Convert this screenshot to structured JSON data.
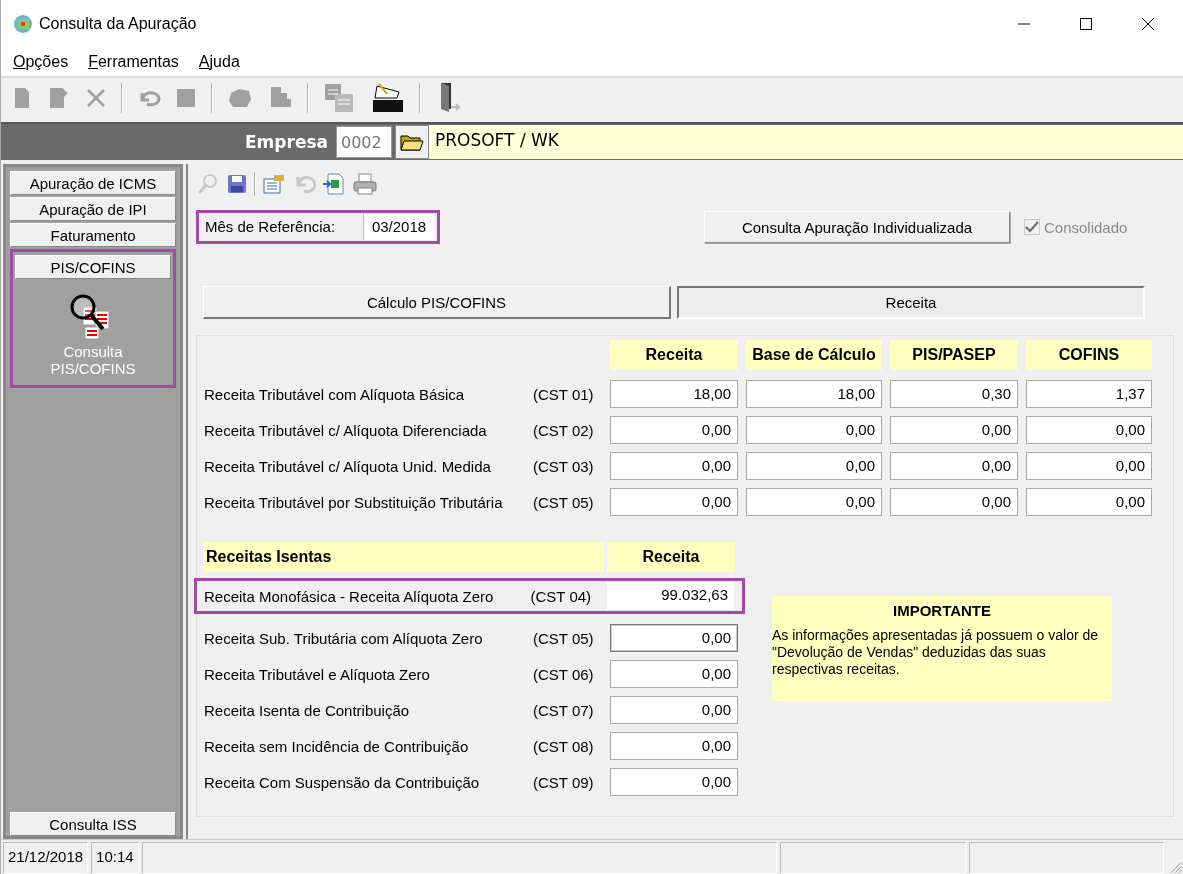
{
  "window": {
    "title": "Consulta da Apuração"
  },
  "menu": [
    {
      "label": "Opções"
    },
    {
      "label": "Ferramentas"
    },
    {
      "label": "Ajuda"
    }
  ],
  "empresa": {
    "label": "Empresa",
    "code": "0002",
    "name": "PROSOFT / WK"
  },
  "sidebar": {
    "items": [
      {
        "label": "Apuração de ICMS",
        "selected": false,
        "highlighted": false
      },
      {
        "label": "Apuração de IPI",
        "selected": false,
        "highlighted": false
      },
      {
        "label": "Faturamento",
        "selected": false,
        "highlighted": false
      },
      {
        "label": "PIS/COFINS",
        "selected": true,
        "highlighted": true
      }
    ],
    "launcher": {
      "label": "Consulta PIS/COFINS"
    },
    "bottom_item": {
      "label": "Consulta ISS"
    }
  },
  "reference": {
    "label": "Mês de Referência:",
    "value": "03/2018",
    "highlighted": true
  },
  "individual_button": {
    "label": "Consulta Apuração Individualizada"
  },
  "consolidated": {
    "label": "Consolidado",
    "checked": true,
    "disabled": true
  },
  "tabs": [
    {
      "label": "Cálculo PIS/COFINS",
      "selected": false
    },
    {
      "label": "Receita",
      "selected": true
    }
  ],
  "taxed": {
    "columns": [
      "Receita",
      "Base de Cálculo",
      "PIS/PASEP",
      "COFINS"
    ],
    "rows": [
      {
        "label": "Receita Tributável com Alíquota Básica",
        "cst": "(CST 01)",
        "values": [
          "18,00",
          "18,00",
          "0,30",
          "1,37"
        ]
      },
      {
        "label": "Receita Tributável c/ Alíquota Diferenciada",
        "cst": "(CST 02)",
        "values": [
          "0,00",
          "0,00",
          "0,00",
          "0,00"
        ]
      },
      {
        "label": "Receita Tributável c/ Alíquota Unid. Medida",
        "cst": "(CST 03)",
        "values": [
          "0,00",
          "0,00",
          "0,00",
          "0,00"
        ]
      },
      {
        "label": "Receita Tributável por Substituição Tributária",
        "cst": "(CST 05)",
        "values": [
          "0,00",
          "0,00",
          "0,00",
          "0,00"
        ]
      }
    ]
  },
  "exempt": {
    "title": "Receitas Isentas",
    "column": "Receita",
    "rows": [
      {
        "label": "Receita Monofásica - Receita Alíquota Zero",
        "cst": "(CST 04)",
        "value": "99.032,63",
        "highlighted": true,
        "focused": false
      },
      {
        "label": "Receita Sub. Tributária com Alíquota Zero",
        "cst": "(CST 05)",
        "value": "0,00",
        "highlighted": false,
        "focused": true
      },
      {
        "label": "Receita Tributável e Alíquota Zero",
        "cst": "(CST 06)",
        "value": "0,00",
        "highlighted": false,
        "focused": false
      },
      {
        "label": "Receita Isenta de Contribuição",
        "cst": "(CST 07)",
        "value": "0,00",
        "highlighted": false,
        "focused": false
      },
      {
        "label": "Receita sem Incidência de Contribuição",
        "cst": "(CST 08)",
        "value": "0,00",
        "highlighted": false,
        "focused": false
      },
      {
        "label": "Receita Com Suspensão da Contribuição",
        "cst": "(CST 09)",
        "value": "0,00",
        "highlighted": false,
        "focused": false
      }
    ]
  },
  "notice": {
    "title": "IMPORTANTE",
    "text": "As informações apresentadas já possuem o valor de \"Devolução de Vendas\" deduzidas das suas respectivas receitas."
  },
  "status_bar": {
    "date": "21/12/2018",
    "time": "10:14"
  }
}
